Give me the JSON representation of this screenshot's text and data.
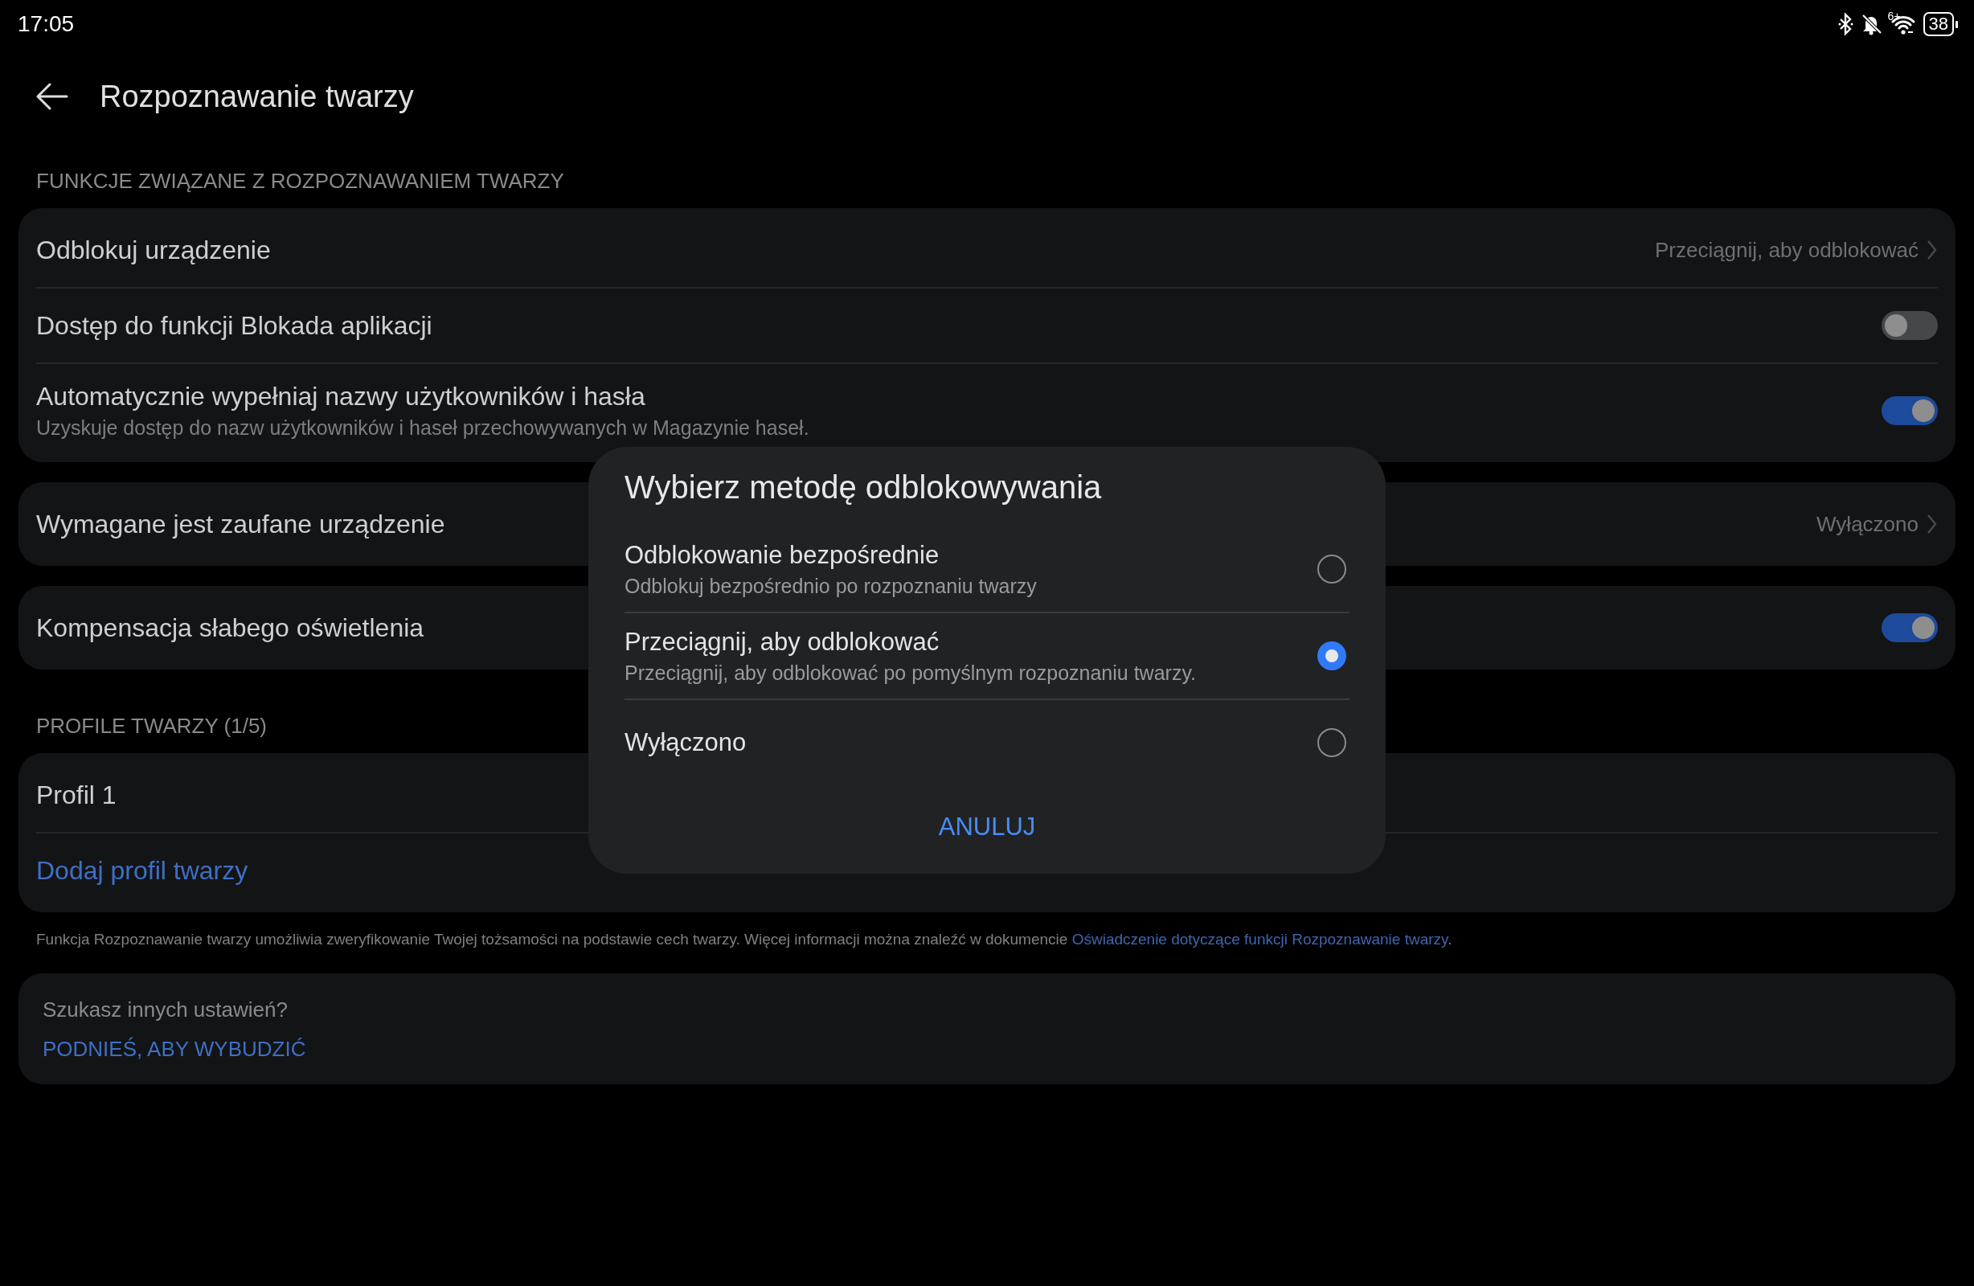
{
  "status_bar": {
    "time": "17:05",
    "network": "6+",
    "battery": "38"
  },
  "header": {
    "title": "Rozpoznawanie twarzy"
  },
  "groups": [
    {
      "kind": "section_title",
      "text": "FUNKCJE ZWIĄZANE Z ROZPOZNAWANIEM TWARZY"
    },
    {
      "kind": "card",
      "rows": [
        {
          "kind": "link",
          "label": "Odblokuj urządzenie",
          "value": "Przeciągnij, aby odblokować"
        },
        {
          "kind": "toggle",
          "label": "Dostęp do funkcji Blokada aplikacji",
          "on": false
        },
        {
          "kind": "toggle",
          "label": "Automatycznie wypełniaj nazwy użytkowników i hasła",
          "description": "Uzyskuje dostęp do nazw użytkowników i haseł przechowywanych w Magazynie haseł.",
          "on": true
        }
      ]
    },
    {
      "kind": "card",
      "rows": [
        {
          "kind": "link",
          "label": "Wymagane jest zaufane urządzenie",
          "value": "Wyłączono"
        }
      ]
    },
    {
      "kind": "card",
      "rows": [
        {
          "kind": "toggle",
          "label": "Kompensacja słabego oświetlenia",
          "on": true
        }
      ]
    },
    {
      "kind": "section_title",
      "text": "PROFILE TWARZY (1/5)"
    },
    {
      "kind": "card",
      "rows": [
        {
          "kind": "plain",
          "label": "Profil 1"
        },
        {
          "kind": "action",
          "label": "Dodaj profil twarzy"
        }
      ]
    },
    {
      "kind": "footnote",
      "text": "Funkcja Rozpoznawanie twarzy umożliwia zweryfikowanie Twojej tożsamości na podstawie cech twarzy. Więcej informacji można znaleźć w dokumencie ",
      "link": "Oświadczenie dotyczące funkcji Rozpoznawanie twarzy",
      "end": "."
    },
    {
      "kind": "suggestion",
      "title": "Szukasz innych ustawień?",
      "link": "PODNIEŚ, ABY WYBUDZIĆ"
    }
  ],
  "dialog": {
    "title": "Wybierz metodę odblokowywania",
    "options": [
      {
        "label": "Odblokowanie bezpośrednie",
        "description": "Odblokuj bezpośrednio po rozpoznaniu twarzy",
        "selected": false
      },
      {
        "label": "Przeciągnij, aby odblokować",
        "description": "Przeciągnij, aby odblokować po pomyślnym rozpoznaniu twarzy.",
        "selected": true
      },
      {
        "label": "Wyłączono",
        "selected": false
      }
    ],
    "cancel": "ANULUJ"
  }
}
